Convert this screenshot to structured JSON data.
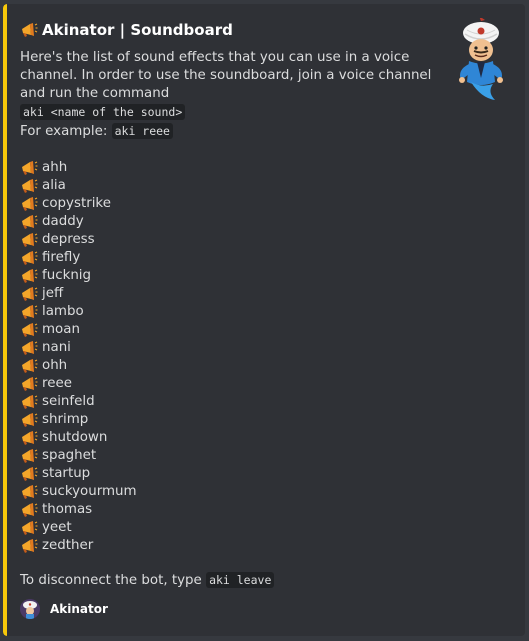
{
  "embed": {
    "accent_color": "#f7c80a",
    "title": "Akinator | Soundboard",
    "title_icon": "loudspeaker-icon",
    "description_line": "Here's the list of sound effects that you can use in a voice channel. In order to use the soundboard, join a voice channel and run the command",
    "command_template": "aki <name of the sound>",
    "example_prefix": "For example:",
    "example_command": "aki reee",
    "sounds": [
      "ahh",
      "alia",
      "copystrike",
      "daddy",
      "depress",
      "firefly",
      "fucknig",
      "jeff",
      "lambo",
      "moan",
      "nani",
      "ohh",
      "reee",
      "seinfeld",
      "shrimp",
      "shutdown",
      "spaghet",
      "startup",
      "suckyourmum",
      "thomas",
      "yeet",
      "zedther"
    ],
    "disconnect_prefix": "To disconnect the bot, type",
    "disconnect_command": "aki leave",
    "footer_name": "Akinator",
    "thumbnail_icon": "akinator-genie-icon"
  }
}
